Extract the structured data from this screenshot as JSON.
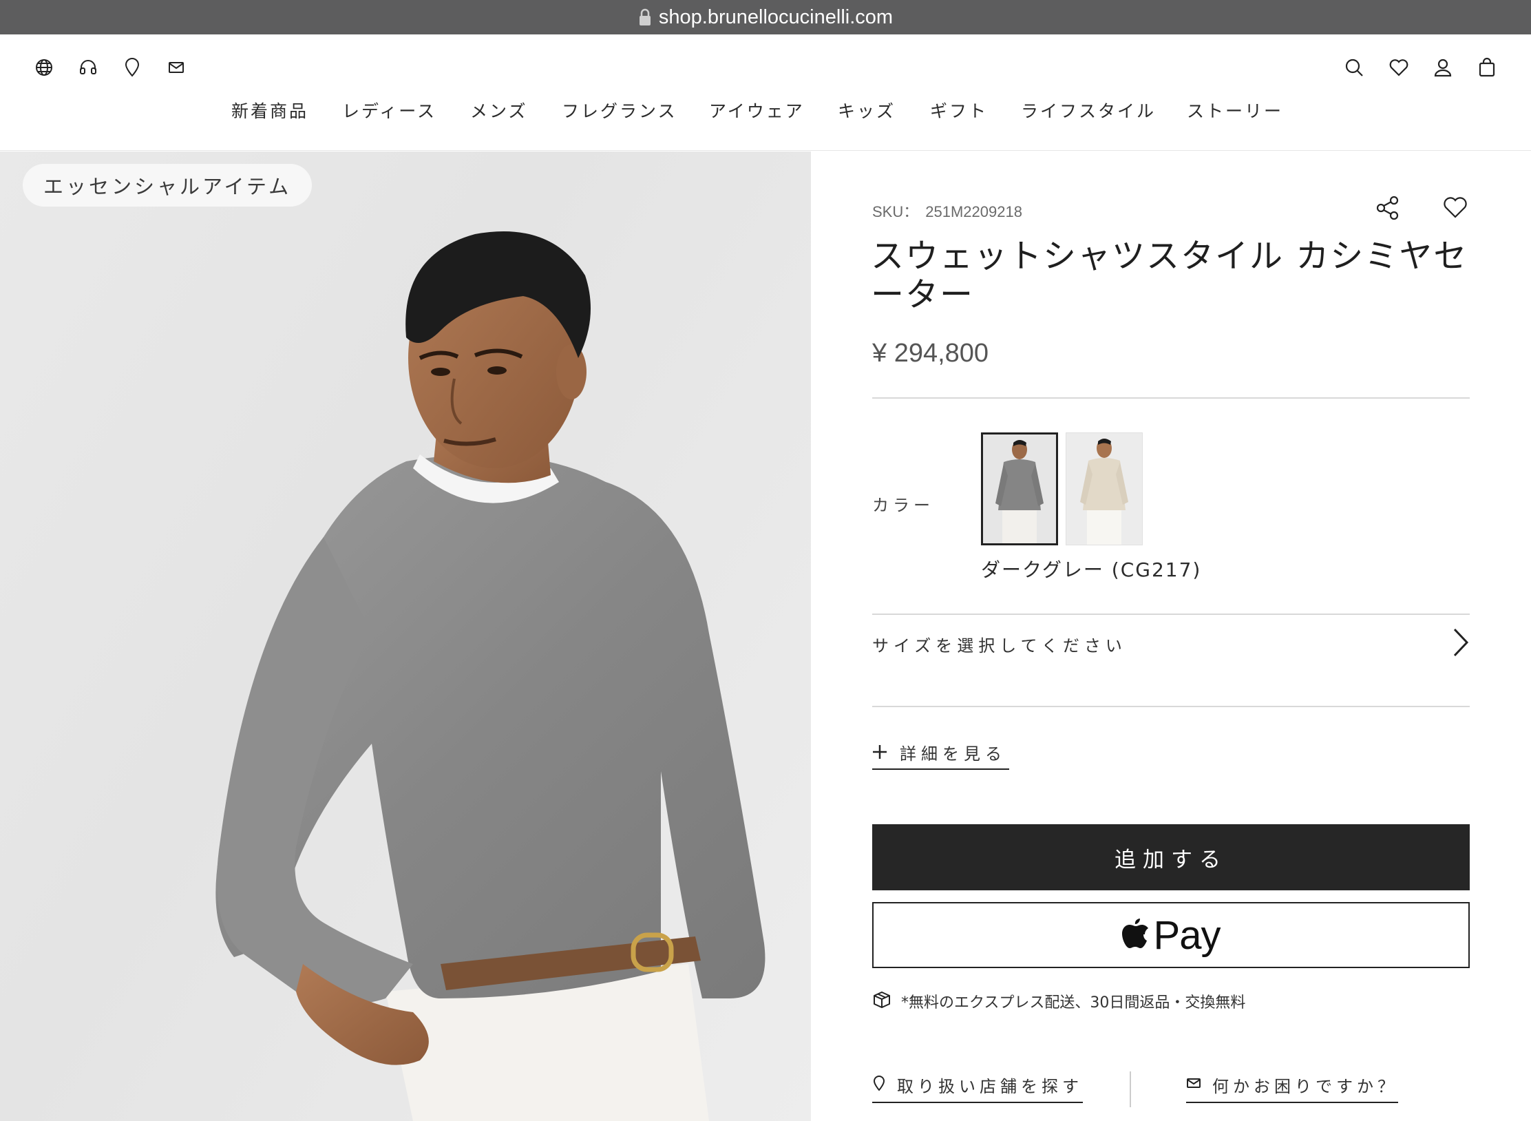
{
  "browser": {
    "url": "shop.brunellocucinelli.com"
  },
  "header": {
    "utility_icons": [
      "globe-icon",
      "headset-icon",
      "location-pin-icon",
      "mail-icon"
    ],
    "action_icons": [
      "search-icon",
      "heart-icon",
      "user-icon",
      "shopping-bag-icon"
    ],
    "nav": [
      "新着商品",
      "レディース",
      "メンズ",
      "フレグランス",
      "アイウェア",
      "キッズ",
      "ギフト",
      "ライフスタイル",
      "ストーリー"
    ]
  },
  "hero": {
    "badge": "エッセンシャルアイテム"
  },
  "product": {
    "sku_label": "SKU：",
    "sku": "251M2209218",
    "title": "スウェットシャツスタイル カシミヤセーター",
    "price": "¥ 294,800",
    "color_label": "カラー",
    "selected_color": "ダークグレー (CG217)",
    "swatches": [
      "dark-grey",
      "beige"
    ],
    "size_prompt": "サイズを選択してください",
    "details_label": "詳細を見る",
    "add_button": "追加する",
    "applepay_label": "Pay",
    "shipping_note": "*無料のエクスプレス配送、30日間返品・交換無料",
    "store_link": "取り扱い店舗を探す",
    "help_link": "何かお困りですか？"
  },
  "colors": {
    "urlbar": "#5d5d5e",
    "button_dark": "#262626",
    "sweater": "#8a8a8a"
  }
}
